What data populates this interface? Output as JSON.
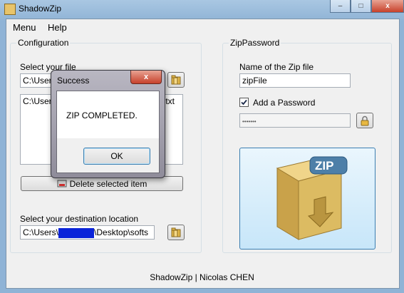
{
  "window": {
    "title": "ShadowZip"
  },
  "menu": {
    "items": [
      "Menu",
      "Help"
    ]
  },
  "configuration": {
    "group_label": "Configuration",
    "select_file_label": "Select your file",
    "file_path_visible": "C:\\Users",
    "list_item_prefix": "C:\\Users",
    "list_item_suffix": "txt",
    "delete_button": "Delete selected item",
    "destination_label": "Select your destination location",
    "destination_prefix": "C:\\Users\\",
    "destination_suffix": "\\Desktop\\softs"
  },
  "zip_password": {
    "group_label": "ZipPassword",
    "name_label": "Name of the Zip file",
    "name_value": "zipFile",
    "add_password_label": "Add a Password",
    "add_password_checked": true,
    "password_value": "•••••••"
  },
  "dialog": {
    "title": "Success",
    "message": "ZIP COMPLETED.",
    "ok_label": "OK",
    "close_glyph": "x"
  },
  "zip_graphic": {
    "badge": "ZIP"
  },
  "footer": {
    "text": "ShadowZip | Nicolas CHEN"
  },
  "icons": {
    "folder": "folder-icon",
    "lock": "lock-icon",
    "delete": "delete-icon",
    "zip_box": "zip-box-icon"
  }
}
